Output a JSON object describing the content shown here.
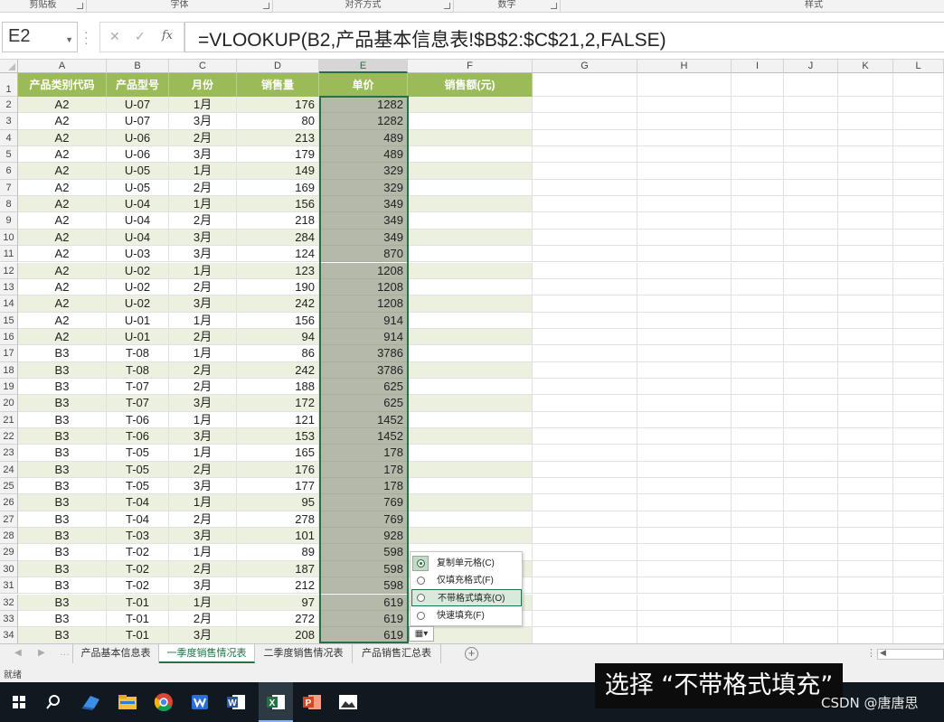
{
  "ribbon": {
    "groups": [
      "剪贴板",
      "字体",
      "对齐方式",
      "数字",
      "样式"
    ]
  },
  "formula_bar": {
    "name_box": "E2",
    "formula": "=VLOOKUP(B2,产品基本信息表!$B$2:$C$21,2,FALSE)"
  },
  "grid": {
    "columns": [
      "A",
      "B",
      "C",
      "D",
      "E",
      "F",
      "G",
      "H",
      "I",
      "J",
      "K",
      "L"
    ],
    "selected_column": "E",
    "headers": [
      "产品类别代码",
      "产品型号",
      "月份",
      "销售量",
      "单价",
      "销售额(元)"
    ],
    "row_numbers": [
      "1",
      "2",
      "3",
      "4",
      "5",
      "6",
      "7",
      "8",
      "9",
      "10",
      "11",
      "12",
      "13",
      "14",
      "15",
      "16",
      "17",
      "18",
      "19",
      "20",
      "21",
      "22",
      "23",
      "24",
      "25",
      "26",
      "27",
      "28",
      "29",
      "30",
      "31",
      "32",
      "33",
      "34"
    ],
    "rows": [
      [
        "A2",
        "U-07",
        "1月",
        "176",
        "1282"
      ],
      [
        "A2",
        "U-07",
        "3月",
        "80",
        "1282"
      ],
      [
        "A2",
        "U-06",
        "2月",
        "213",
        "489"
      ],
      [
        "A2",
        "U-06",
        "3月",
        "179",
        "489"
      ],
      [
        "A2",
        "U-05",
        "1月",
        "149",
        "329"
      ],
      [
        "A2",
        "U-05",
        "2月",
        "169",
        "329"
      ],
      [
        "A2",
        "U-04",
        "1月",
        "156",
        "349"
      ],
      [
        "A2",
        "U-04",
        "2月",
        "218",
        "349"
      ],
      [
        "A2",
        "U-04",
        "3月",
        "284",
        "349"
      ],
      [
        "A2",
        "U-03",
        "3月",
        "124",
        "870"
      ],
      [
        "A2",
        "U-02",
        "1月",
        "123",
        "1208"
      ],
      [
        "A2",
        "U-02",
        "2月",
        "190",
        "1208"
      ],
      [
        "A2",
        "U-02",
        "3月",
        "242",
        "1208"
      ],
      [
        "A2",
        "U-01",
        "1月",
        "156",
        "914"
      ],
      [
        "A2",
        "U-01",
        "2月",
        "94",
        "914"
      ],
      [
        "B3",
        "T-08",
        "1月",
        "86",
        "3786"
      ],
      [
        "B3",
        "T-08",
        "2月",
        "242",
        "3786"
      ],
      [
        "B3",
        "T-07",
        "2月",
        "188",
        "625"
      ],
      [
        "B3",
        "T-07",
        "3月",
        "172",
        "625"
      ],
      [
        "B3",
        "T-06",
        "1月",
        "121",
        "1452"
      ],
      [
        "B3",
        "T-06",
        "3月",
        "153",
        "1452"
      ],
      [
        "B3",
        "T-05",
        "1月",
        "165",
        "178"
      ],
      [
        "B3",
        "T-05",
        "2月",
        "176",
        "178"
      ],
      [
        "B3",
        "T-05",
        "3月",
        "177",
        "178"
      ],
      [
        "B3",
        "T-04",
        "1月",
        "95",
        "769"
      ],
      [
        "B3",
        "T-04",
        "2月",
        "278",
        "769"
      ],
      [
        "B3",
        "T-03",
        "3月",
        "101",
        "928"
      ],
      [
        "B3",
        "T-02",
        "1月",
        "89",
        "598"
      ],
      [
        "B3",
        "T-02",
        "2月",
        "187",
        "598"
      ],
      [
        "B3",
        "T-02",
        "3月",
        "212",
        "598"
      ],
      [
        "B3",
        "T-01",
        "1月",
        "97",
        "619"
      ],
      [
        "B3",
        "T-01",
        "2月",
        "272",
        "619"
      ],
      [
        "B3",
        "T-01",
        "3月",
        "208",
        "619"
      ]
    ]
  },
  "autofill_menu": {
    "items": [
      "复制单元格(C)",
      "仅填充格式(F)",
      "不带格式填充(O)",
      "快速填充(F)"
    ],
    "checked_index": 0,
    "hover_index": 2
  },
  "sheet_tabs": {
    "tabs": [
      "产品基本信息表",
      "一季度销售情况表",
      "二季度销售情况表",
      "产品销售汇总表"
    ],
    "active_index": 1
  },
  "status_bar": {
    "text": "就绪"
  },
  "subtitle": "选择 “不带格式填充”",
  "watermark": "CSDN @唐唐思",
  "colors": {
    "header_green": "#9bbb59",
    "band_green": "#ebf1de",
    "selection_fill": "#b4b9aa",
    "excel_green": "#217346"
  }
}
